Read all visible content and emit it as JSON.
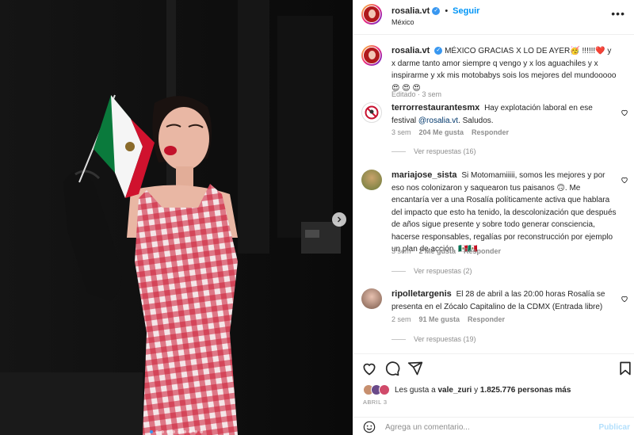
{
  "post": {
    "username": "rosalia.vt",
    "follow_label": "Seguir",
    "separator": "•",
    "location": "México",
    "more_label": "•••"
  },
  "caption": {
    "username": "rosalia.vt",
    "text": "MÉXICO GRACIAS X LO DE AYER🥳 !!!!!!❤️ y x darme tanto amor siempre q vengo y x los aguachiles y x inspirarme y xk mis motobabys sois los mejores del mundooooo😍 😍 😍",
    "edited": "Editado",
    "time": "3 sem"
  },
  "comments": [
    {
      "username": "terrorrestaurantesmx",
      "text_before": "Hay explotación laboral en ese festival",
      "mention": "@rosalia.vt",
      "text_after": ". Saludos.",
      "time": "3 sem",
      "likes": "204 Me gusta",
      "reply": "Responder",
      "view_replies": "Ver respuestas (16)"
    },
    {
      "username": "mariajose_sista",
      "text": "Si Motomamiiiii, somos les mejores y por eso nos colonizaron y saquearon tus paisanos 🙃. Me encantaría ver a una Rosalía políticamente activa que hablara del impacto que esto ha tenido, la descolonización que después de años sigue presente y sobre todo generar consciencia, hacerse responsables, regalías por reconstrucción por ejemplo un plan de acción. 🇲🇽🇲🇽",
      "time": "3 sem",
      "likes": "2 Me gusta",
      "reply": "Responder",
      "view_replies": "Ver respuestas (2)"
    },
    {
      "username": "ripolletargenis",
      "text": "El 28 de abril a las 20:00 horas Rosalía se presenta en el Zócalo Capitalino de la CDMX (Entrada libre)",
      "time": "2 sem",
      "likes": "91 Me gusta",
      "reply": "Responder",
      "view_replies": "Ver respuestas (19)"
    }
  ],
  "actions": {
    "like_icon": "heart-icon",
    "comment_icon": "comment-icon",
    "share_icon": "share-icon",
    "save_icon": "bookmark-icon"
  },
  "likes": {
    "prefix": "Les gusta a",
    "user": "vale_zuri",
    "middle": "y",
    "count": "1.825.776 personas más"
  },
  "date": "ABRIL 3",
  "composer": {
    "placeholder": "Agrega un comentario...",
    "publish_label": "Publicar"
  },
  "carousel": {
    "slide_count": 10,
    "active_index": 0
  },
  "colors": {
    "accent": "#0095f6",
    "verified": "#3897f0",
    "muted": "#8e8e8e",
    "media_bg": "#0c0c0c"
  }
}
